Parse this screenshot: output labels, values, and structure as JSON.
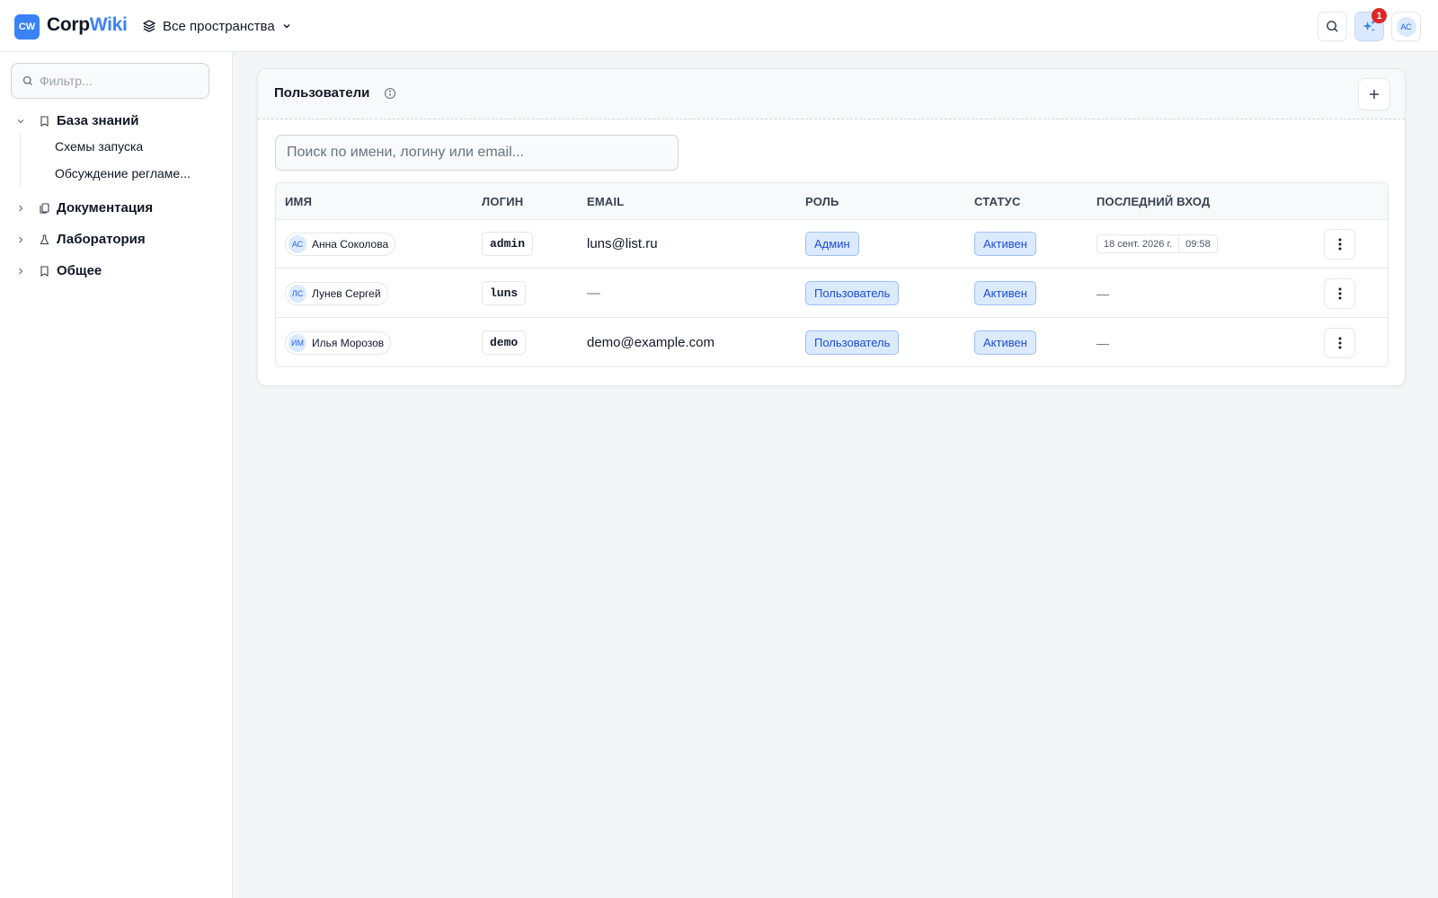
{
  "app": {
    "logo_badge": "CW",
    "logo_corp": "Corp",
    "logo_wiki": "Wiki",
    "space_switcher": "Все пространства",
    "notification_count": "1",
    "user_initials": "АС",
    "brand_color": "#3b82f6"
  },
  "sidebar": {
    "filter_placeholder": "Фильтр...",
    "spaces": [
      {
        "label": "База знаний",
        "icon": "book-icon",
        "expanded": true,
        "children": [
          "Схемы запуска",
          "Обсуждение регламе..."
        ]
      },
      {
        "label": "Документация",
        "icon": "copy-icon",
        "expanded": false
      },
      {
        "label": "Лаборатория",
        "icon": "flask-icon",
        "expanded": false
      },
      {
        "label": "Общее",
        "icon": "book-icon",
        "expanded": false
      }
    ]
  },
  "users_panel": {
    "title": "Пользователи",
    "search_placeholder": "Поиск по имени, логину или email...",
    "columns": [
      "ИМЯ",
      "ЛОГИН",
      "EMAIL",
      "РОЛЬ",
      "СТАТУС",
      "ПОСЛЕДНИЙ ВХОД"
    ],
    "rows": [
      {
        "initials": "АС",
        "name": "Анна Соколова",
        "login": "admin",
        "email": "luns@list.ru",
        "role": "Админ",
        "status": "Активен",
        "last_login_date": "18 сент. 2026 г.",
        "last_login_time": "09:58"
      },
      {
        "initials": "ЛС",
        "name": "Лунев Сергей",
        "login": "luns",
        "email": "—",
        "role": "Пользователь",
        "status": "Активен",
        "last_login": "—"
      },
      {
        "initials": "ИМ",
        "name": "Илья Морозов",
        "login": "demo",
        "email": "demo@example.com",
        "role": "Пользователь",
        "status": "Активен",
        "last_login": "—"
      }
    ]
  },
  "colors": {
    "accent": "#3b82f6",
    "badge_bg": "#dbeafe",
    "badge_text": "#1d4ed8",
    "notification": "#dc2626"
  }
}
